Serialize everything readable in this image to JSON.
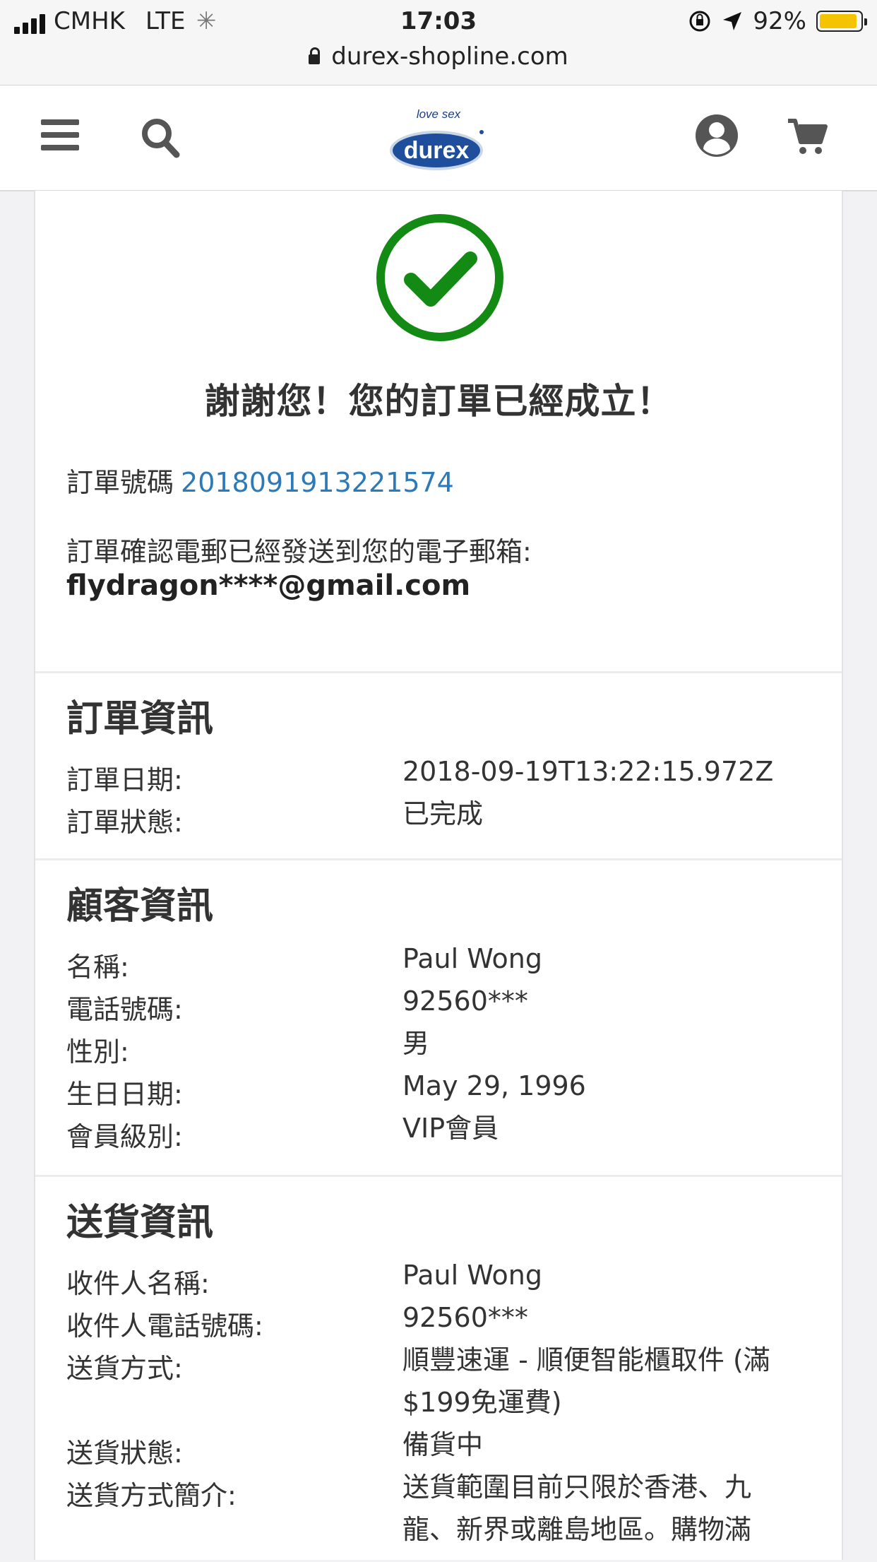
{
  "status_bar": {
    "carrier": "CMHK",
    "network": "LTE",
    "time": "17:03",
    "battery": "92%",
    "battery_level": 0.92,
    "url": "durex-shopline.com"
  },
  "header": {
    "logo_tagline": "love sex",
    "logo_text": "durex"
  },
  "confirmation": {
    "title": "謝謝您！您的訂單已經成立！",
    "order_number_label": "訂單號碼",
    "order_number": "2018091913221574",
    "email_notice": "訂單確認電郵已經發送到您的電子郵箱:",
    "email": "flydragon****@gmail.com"
  },
  "order_info": {
    "title": "訂單資訊",
    "rows": [
      {
        "label": "訂單日期:",
        "value": "2018-09-19T13:22:15.972Z"
      },
      {
        "label": "訂單狀態:",
        "value": "已完成"
      }
    ]
  },
  "customer_info": {
    "title": "顧客資訊",
    "rows": [
      {
        "label": "名稱:",
        "value": "Paul Wong"
      },
      {
        "label": "電話號碼:",
        "value": "92560***"
      },
      {
        "label": "性別:",
        "value": "男"
      },
      {
        "label": "生日日期:",
        "value": "May 29, 1996"
      },
      {
        "label": "會員級別:",
        "value": "VIP會員"
      }
    ]
  },
  "delivery_info": {
    "title": "送貨資訊",
    "rows": [
      {
        "label": "收件人名稱:",
        "value": "Paul Wong"
      },
      {
        "label": "收件人電話號碼:",
        "value": "92560***"
      },
      {
        "label": "送貨方式:",
        "value": "順豐速運 - 順便智能櫃取件 (滿$199免運費)"
      },
      {
        "label": "送貨狀態:",
        "value": "備貨中"
      },
      {
        "label": "送貨方式簡介:",
        "value": "送貨範圍目前只限於香港、九龍、新界或離島地區。購物滿"
      }
    ]
  },
  "colors": {
    "success_green": "#138a13",
    "link_blue": "#2d7ab8",
    "battery_yellow": "#f5c400"
  },
  "icons": [
    "signal-icon",
    "loading-icon",
    "orientation-lock-icon",
    "location-arrow-icon",
    "battery-icon",
    "lock-icon",
    "menu-icon",
    "search-icon",
    "user-icon",
    "cart-icon",
    "success-check-icon"
  ]
}
